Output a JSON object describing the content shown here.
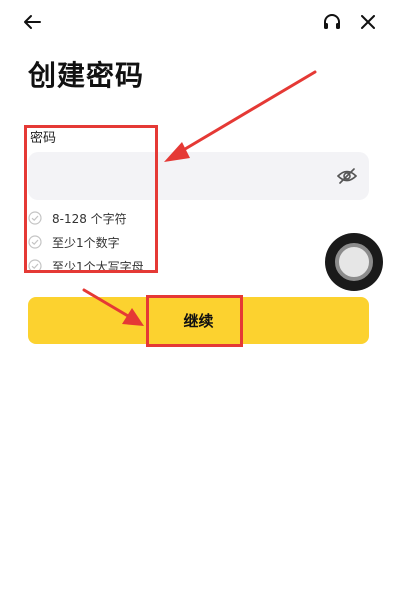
{
  "header": {
    "back_icon": "back-arrow-icon",
    "support_icon": "headset-icon",
    "close_icon": "close-icon"
  },
  "page": {
    "title": "创建密码"
  },
  "password_field": {
    "label": "密码",
    "value": "",
    "visibility_icon": "eye-slash-icon"
  },
  "requirements": [
    {
      "text": "8-128 个字符",
      "icon": "check-circle-icon"
    },
    {
      "text": "至少1个数字",
      "icon": "check-circle-icon"
    },
    {
      "text": "至少1个大写字母",
      "icon": "check-circle-icon"
    }
  ],
  "continue_button": {
    "label": "继续",
    "color": "#fcd22f"
  },
  "overlay": {
    "assistive_icon": "assistive-touch-icon",
    "annotation_color": "#e53935"
  }
}
